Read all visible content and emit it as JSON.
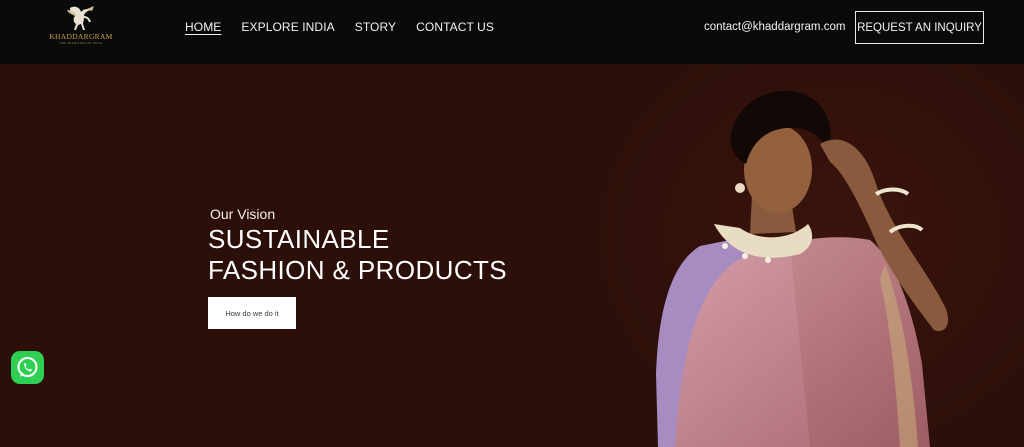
{
  "brand": {
    "name": "KHADDARGRAM",
    "tagline": "THE TRADITION OF INDIA"
  },
  "nav": {
    "items": [
      {
        "label": "HOME",
        "active": true
      },
      {
        "label": "EXPLORE INDIA",
        "active": false
      },
      {
        "label": "STORY",
        "active": false
      },
      {
        "label": "CONTACT US",
        "active": false
      }
    ]
  },
  "header": {
    "email": "contact@khaddargram.com",
    "inquiry_label": "REQUEST AN INQUIRY"
  },
  "hero": {
    "eyebrow": "Our Vision",
    "headline_line1": "SUSTAINABLE",
    "headline_line2": "FASHION & PRODUCTS",
    "cta_label": "How do we do it"
  },
  "icons": {
    "logo": "winged-horse-icon",
    "chat": "whatsapp-icon"
  },
  "colors": {
    "header_bg": "#0a0a0a",
    "hero_bg": "#2c0f09",
    "brand_gold": "#c9a14a",
    "whatsapp_green": "#2fcf53"
  }
}
